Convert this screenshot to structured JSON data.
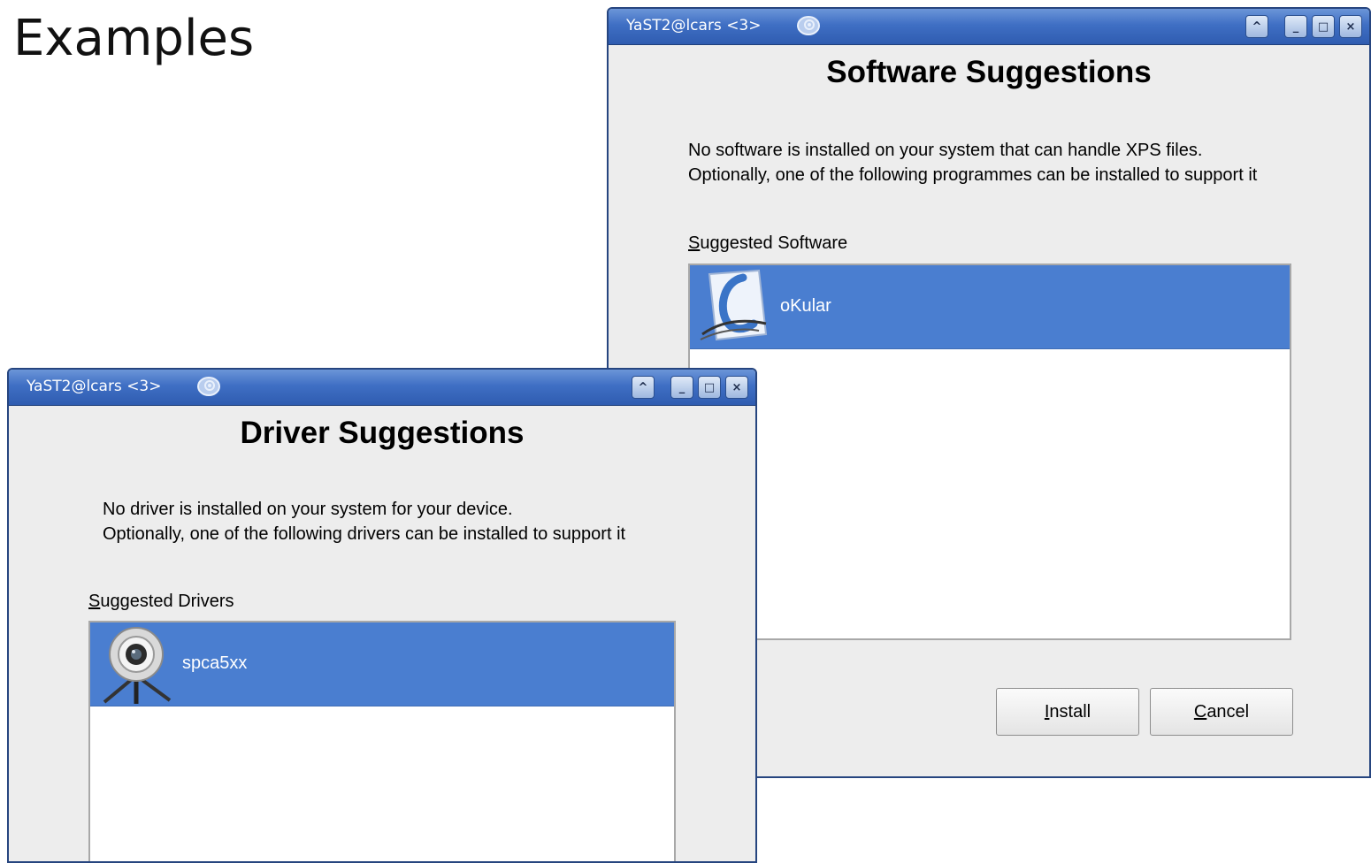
{
  "slide": {
    "heading": "Examples"
  },
  "software_window": {
    "title": "YaST2@lcars <3>",
    "heading": "Software Suggestions",
    "description_line1": "No software is installed on your system that can handle XPS files.",
    "description_line2": "Optionally, one of the following programmes can be installed to support it",
    "list_label_mnemonic": "S",
    "list_label_rest": "uggested Software",
    "items": [
      {
        "label": "oKular",
        "icon": "okular-icon",
        "selected": true
      }
    ],
    "install_mnemonic": "I",
    "install_rest": "nstall",
    "cancel_mnemonic": "C",
    "cancel_rest": "ancel"
  },
  "driver_window": {
    "title": "YaST2@lcars <3>",
    "heading": "Driver Suggestions",
    "description_line1": "No driver is installed on your system for your device.",
    "description_line2": "Optionally, one of the following drivers can be installed to support it",
    "list_label_mnemonic": "S",
    "list_label_rest": "uggested Drivers",
    "items": [
      {
        "label": "spca5xx",
        "icon": "webcam-icon",
        "selected": true
      }
    ]
  },
  "titlebar_buttons": {
    "shade": "^",
    "minimize": "_",
    "maximize": "□",
    "close": "×"
  },
  "colors": {
    "titlebar": "#3f6fc4",
    "selection": "#4a7ed0",
    "window_bg": "#ededed"
  }
}
